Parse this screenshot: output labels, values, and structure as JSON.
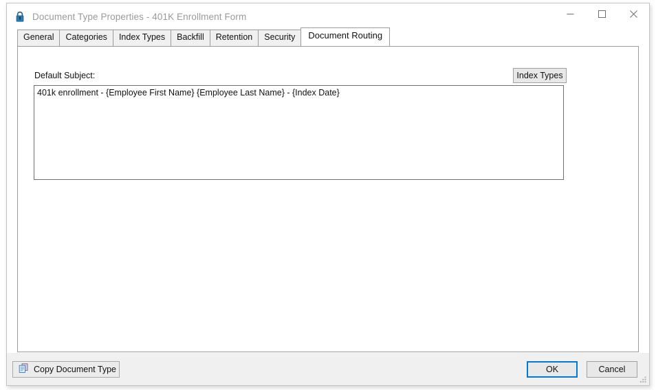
{
  "window": {
    "title_main": "Document Type Properties",
    "title_sub": " - 401K Enrollment Form",
    "icon": "lock-icon",
    "controls": {
      "minimize": "minimize-icon",
      "maximize": "maximize-icon",
      "close": "close-icon"
    }
  },
  "tabs": [
    {
      "label": "General",
      "active": false
    },
    {
      "label": "Categories",
      "active": false
    },
    {
      "label": "Index Types",
      "active": false
    },
    {
      "label": "Backfill",
      "active": false
    },
    {
      "label": "Retention",
      "active": false
    },
    {
      "label": "Security",
      "active": false
    },
    {
      "label": "Document Routing",
      "active": true
    }
  ],
  "panel": {
    "subject_label": "Default Subject:",
    "index_types_button": "Index Types",
    "subject_value": "401k enrollment - {Employee First Name} {Employee Last Name} - {Index Date}",
    "subject_placeholder": ""
  },
  "footer": {
    "copy_document_type": "Copy Document Type",
    "copy_icon": "copy-documents-icon",
    "ok": "OK",
    "cancel": "Cancel",
    "resize_grip": "resize-grip-icon"
  },
  "colors": {
    "accent": "#0078d7",
    "title_text": "#9a9a9a",
    "panel_border": "#9b9b9b",
    "bottom_bar": "#f0f0f0"
  }
}
